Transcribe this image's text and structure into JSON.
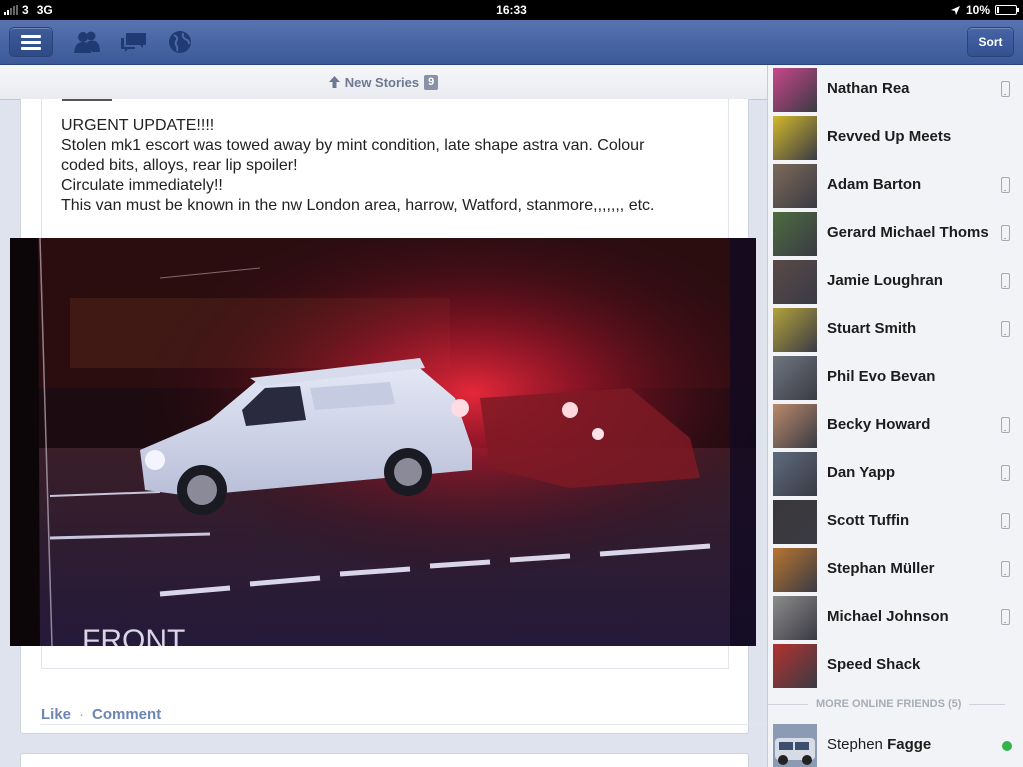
{
  "status_bar": {
    "carrier": "3",
    "network": "3G",
    "time": "16:33",
    "battery": "10%",
    "battery_level": 0.1
  },
  "navbar": {
    "sort_label": "Sort"
  },
  "feed": {
    "new_stories_label": "New Stories",
    "new_stories_count": "9",
    "story": {
      "lines": [
        "URGENT UPDATE!!!!",
        "Stolen mk1 escort was towed away by mint condition, late shape astra van. Colour",
        "coded bits, alloys, rear lip spoiler!",
        "Circulate immediately!!",
        "This van must be known in the nw London area, harrow, Watford, stanmore,,,,,,, etc."
      ],
      "photo_caption": "FRONT"
    },
    "actions": {
      "like": "Like",
      "separator": "·",
      "comment": "Comment"
    }
  },
  "sidebar": {
    "friends": [
      {
        "name": "Nathan Rea",
        "mobile": true,
        "avatar_color": "#c8478a"
      },
      {
        "name": "Revved Up Meets",
        "mobile": false,
        "avatar_color": "#d1b82a"
      },
      {
        "name": "Adam Barton",
        "mobile": true,
        "avatar_color": "#7c6a58"
      },
      {
        "name": "Gerard Michael Thomson",
        "mobile": true,
        "avatar_color": "#4d6c3e"
      },
      {
        "name": "Jamie Loughran",
        "mobile": true,
        "avatar_color": "#5a4a48"
      },
      {
        "name": "Stuart Smith",
        "mobile": true,
        "avatar_color": "#b2a23a"
      },
      {
        "name": "Phil Evo Bevan",
        "mobile": false,
        "avatar_color": "#6f7680"
      },
      {
        "name": "Becky Howard",
        "mobile": true,
        "avatar_color": "#b98a6a"
      },
      {
        "name": "Dan Yapp",
        "mobile": true,
        "avatar_color": "#5d6b7d"
      },
      {
        "name": "Scott Tuffin",
        "mobile": true,
        "avatar_color": "#3a3838"
      },
      {
        "name": "Stephan Müller",
        "mobile": true,
        "avatar_color": "#b8752e"
      },
      {
        "name": "Michael Johnson",
        "mobile": true,
        "avatar_color": "#8c8c8c"
      },
      {
        "name": "Speed Shack",
        "mobile": false,
        "avatar_color": "#b3322f"
      }
    ],
    "more_online_label": "MORE ONLINE FRIENDS (5)",
    "online_friend": {
      "first_name": "Stephen",
      "last_name": "Fagge",
      "status_color": "#33b44a"
    }
  }
}
